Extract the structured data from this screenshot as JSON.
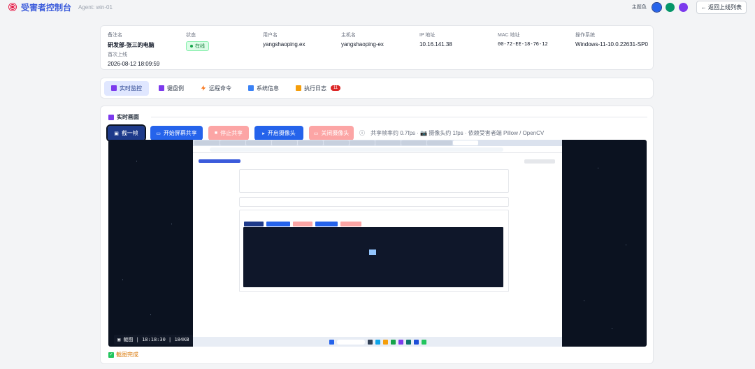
{
  "header": {
    "title": "受害者控制台",
    "agent": "Agent: win-01",
    "theme_label": "主题色",
    "theme_colors": [
      "#2563eb",
      "#059669",
      "#7c3aed"
    ],
    "back_label": "← 返回上线列表"
  },
  "info": {
    "remark": {
      "label": "备注名",
      "value": "研发部-张三的电脑"
    },
    "status": {
      "label": "状态",
      "value": "在线"
    },
    "username": {
      "label": "用户名",
      "value": "yangshaoping.ex"
    },
    "hostname": {
      "label": "主机名",
      "value": "yangshaoping-ex"
    },
    "ip": {
      "label": "IP 地址",
      "value": "10.16.141.38"
    },
    "mac": {
      "label": "MAC 地址",
      "value": "00-72-EE-18-76-12"
    },
    "os": {
      "label": "操作系统",
      "value": "Windows-11-10.0.22631-SP0"
    },
    "first": {
      "label": "首次上线",
      "value": "2026-08-12 18:09:59"
    }
  },
  "tabs": [
    {
      "label": "实时监控",
      "icon": "monitor-icon",
      "color": "#7c3aed"
    },
    {
      "label": "键盘例",
      "icon": "keyboard-icon",
      "color": "#7c3aed"
    },
    {
      "label": "远程命令",
      "icon": "bolt-icon",
      "color": "#f97316"
    },
    {
      "label": "系统信息",
      "icon": "info-icon",
      "color": "#3b82f6"
    },
    {
      "label": "执行日志",
      "icon": "log-icon",
      "color": "#f59e0b",
      "count": "11"
    }
  ],
  "live": {
    "section_title": "实时画面",
    "buttons": {
      "capture": "截一帧",
      "start_share": "开始屏幕共享",
      "stop_share": "停止共享",
      "open_cam": "开启摄像头",
      "close_cam": "关闭摄像头"
    },
    "note": "共享帧率约 0.7fps · 📷 摄像头约 1fps · 依赖受害者端 Pillow / OpenCV",
    "overlay": "截图 | 18:18:30 | 184KB",
    "done": "截图完成"
  }
}
